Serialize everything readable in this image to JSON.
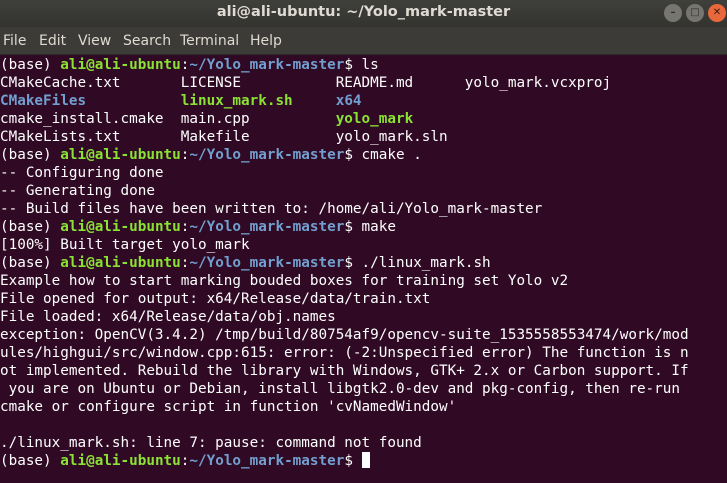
{
  "window": {
    "title": "ali@ali-ubuntu: ~/Yolo_mark-master",
    "minimize_glyph": "–",
    "maximize_glyph": "□",
    "close_glyph": "✕",
    "minimize_icon": "minimize-icon",
    "maximize_icon": "maximize-icon",
    "close_icon": "close-icon"
  },
  "menubar": {
    "items": [
      "File",
      "Edit",
      "View",
      "Search",
      "Terminal",
      "Help"
    ]
  },
  "colors": {
    "terminal_bg": "#300a24",
    "prompt_user": "#8ae234",
    "prompt_path": "#729fcf",
    "directory": "#729fcf",
    "executable": "#8ae234",
    "text": "#ffffff"
  },
  "terminal": {
    "lines": [
      [
        {
          "t": "(base) ",
          "c": "white"
        },
        {
          "t": "ali@ali-ubuntu",
          "c": "green"
        },
        {
          "t": ":",
          "c": "white"
        },
        {
          "t": "~/Yolo_mark-master",
          "c": "blue"
        },
        {
          "t": "$ ls",
          "c": "white"
        }
      ],
      [
        {
          "t": "CMakeCache.txt       LICENSE           README.md      yolo_mark.vcxproj",
          "c": "white"
        }
      ],
      [
        {
          "t": "CMakeFiles",
          "c": "blue"
        },
        {
          "t": "           ",
          "c": "white"
        },
        {
          "t": "linux_mark.sh",
          "c": "green"
        },
        {
          "t": "     ",
          "c": "white"
        },
        {
          "t": "x64",
          "c": "blue"
        }
      ],
      [
        {
          "t": "cmake_install.cmake  main.cpp          ",
          "c": "white"
        },
        {
          "t": "yolo_mark",
          "c": "green"
        }
      ],
      [
        {
          "t": "CMakeLists.txt       Makefile          yolo_mark.sln",
          "c": "white"
        }
      ],
      [
        {
          "t": "(base) ",
          "c": "white"
        },
        {
          "t": "ali@ali-ubuntu",
          "c": "green"
        },
        {
          "t": ":",
          "c": "white"
        },
        {
          "t": "~/Yolo_mark-master",
          "c": "blue"
        },
        {
          "t": "$ cmake .",
          "c": "white"
        }
      ],
      [
        {
          "t": "-- Configuring done",
          "c": "white"
        }
      ],
      [
        {
          "t": "-- Generating done",
          "c": "white"
        }
      ],
      [
        {
          "t": "-- Build files have been written to: /home/ali/Yolo_mark-master",
          "c": "white"
        }
      ],
      [
        {
          "t": "(base) ",
          "c": "white"
        },
        {
          "t": "ali@ali-ubuntu",
          "c": "green"
        },
        {
          "t": ":",
          "c": "white"
        },
        {
          "t": "~/Yolo_mark-master",
          "c": "blue"
        },
        {
          "t": "$ make",
          "c": "white"
        }
      ],
      [
        {
          "t": "[100%] Built target yolo_mark",
          "c": "white"
        }
      ],
      [
        {
          "t": "(base) ",
          "c": "white"
        },
        {
          "t": "ali@ali-ubuntu",
          "c": "green"
        },
        {
          "t": ":",
          "c": "white"
        },
        {
          "t": "~/Yolo_mark-master",
          "c": "blue"
        },
        {
          "t": "$ ./linux_mark.sh",
          "c": "white"
        }
      ],
      [
        {
          "t": "Example how to start marking bouded boxes for training set Yolo v2",
          "c": "white"
        }
      ],
      [
        {
          "t": "File opened for output: x64/Release/data/train.txt",
          "c": "white"
        }
      ],
      [
        {
          "t": "File loaded: x64/Release/data/obj.names",
          "c": "white"
        }
      ],
      [
        {
          "t": "exception: OpenCV(3.4.2) /tmp/build/80754af9/opencv-suite_1535558553474/work/mod",
          "c": "white"
        }
      ],
      [
        {
          "t": "ules/highgui/src/window.cpp:615: error: (-2:Unspecified error) The function is n",
          "c": "white"
        }
      ],
      [
        {
          "t": "ot implemented. Rebuild the library with Windows, GTK+ 2.x or Carbon support. If",
          "c": "white"
        }
      ],
      [
        {
          "t": " you are on Ubuntu or Debian, install libgtk2.0-dev and pkg-config, then re-run ",
          "c": "white"
        }
      ],
      [
        {
          "t": "cmake or configure script in function 'cvNamedWindow'",
          "c": "white"
        }
      ],
      [
        {
          "t": "",
          "c": "white"
        }
      ],
      [
        {
          "t": "./linux_mark.sh: line 7: pause: command not found",
          "c": "white"
        }
      ],
      [
        {
          "t": "(base) ",
          "c": "white"
        },
        {
          "t": "ali@ali-ubuntu",
          "c": "green"
        },
        {
          "t": ":",
          "c": "white"
        },
        {
          "t": "~/Yolo_mark-master",
          "c": "blue"
        },
        {
          "t": "$ ",
          "c": "white"
        }
      ]
    ]
  }
}
